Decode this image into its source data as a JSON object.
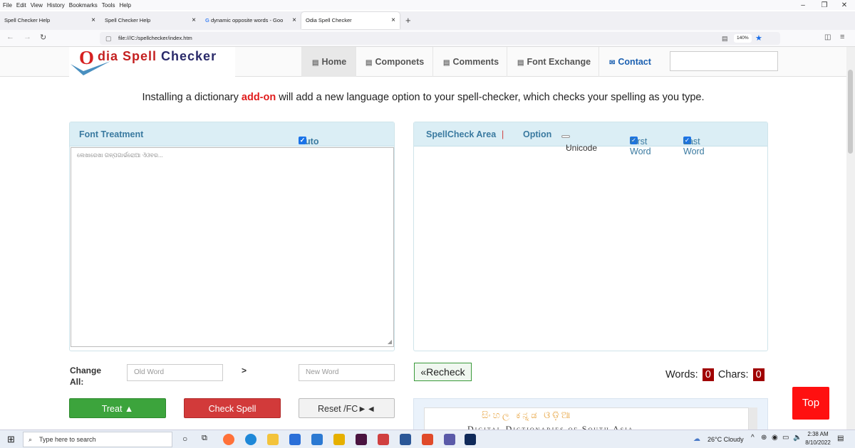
{
  "browser": {
    "menu": [
      "File",
      "Edit",
      "View",
      "History",
      "Bookmarks",
      "Tools",
      "Help"
    ],
    "window_controls": [
      "–",
      "❐",
      "✕"
    ],
    "tabs": [
      {
        "title": "Spell Checker Help"
      },
      {
        "title": "Spell Checker Help"
      },
      {
        "title": "dynamic opposite words - Goo"
      },
      {
        "title": "Odia Spell Checker"
      }
    ],
    "new_tab": "+",
    "url": "file:///C:/spellchecker/index.htm",
    "zoom": "140%"
  },
  "site": {
    "logo": {
      "o": "O",
      "rest_red": "dia Spell ",
      "rest_dark": "Checker"
    },
    "nav": [
      {
        "label": "Home",
        "icon": "file-icon"
      },
      {
        "label": "Componets",
        "icon": "file-icon"
      },
      {
        "label": "Comments",
        "icon": "file-icon"
      },
      {
        "label": "Font Exchange",
        "icon": "file-icon"
      },
      {
        "label": "Contact",
        "icon": "mail-icon"
      }
    ],
    "intro_before": "Installing a dictionary ",
    "intro_highlight": "add-on",
    "intro_after": " will add a new language option to your spell-checker, which checks your spelling as you type.",
    "left_panel": {
      "title": "Font Treatment",
      "auto_correct": "Auto Correct",
      "placeholder": "ଲେଖାରେଖା ଗଳ୍ପଗାର୍ଭରୋଆ ଏଁଓବର..."
    },
    "right_panel": {
      "title": "SpellCheck Area",
      "separator": "|",
      "option_label": "Option",
      "option_value": "Unicode",
      "first_word": "First Word",
      "last_word": "Last Word"
    },
    "change_all": {
      "label": "Change All:",
      "arrow": ">",
      "old_placeholder": "Old Word",
      "new_placeholder": "New Word"
    },
    "recheck": "«Recheck",
    "words_label": "Words:",
    "words_value": "0",
    "chars_label": "Chars:",
    "chars_value": "0",
    "buttons": {
      "treat": "Treat ▲",
      "check": "Check Spell",
      "reset": "Reset /FC►◄"
    },
    "top": "Top",
    "dict": {
      "title": "Digital Dictionaries of South Asia",
      "scripts": "සිංහල  ಕನ್ನಡ  ଓଡ଼ିଆ"
    }
  },
  "taskbar": {
    "search_placeholder": "Type here to search",
    "weather": "26°C  Cloudy",
    "time": "2:38 AM",
    "date": "8/10/2022"
  }
}
